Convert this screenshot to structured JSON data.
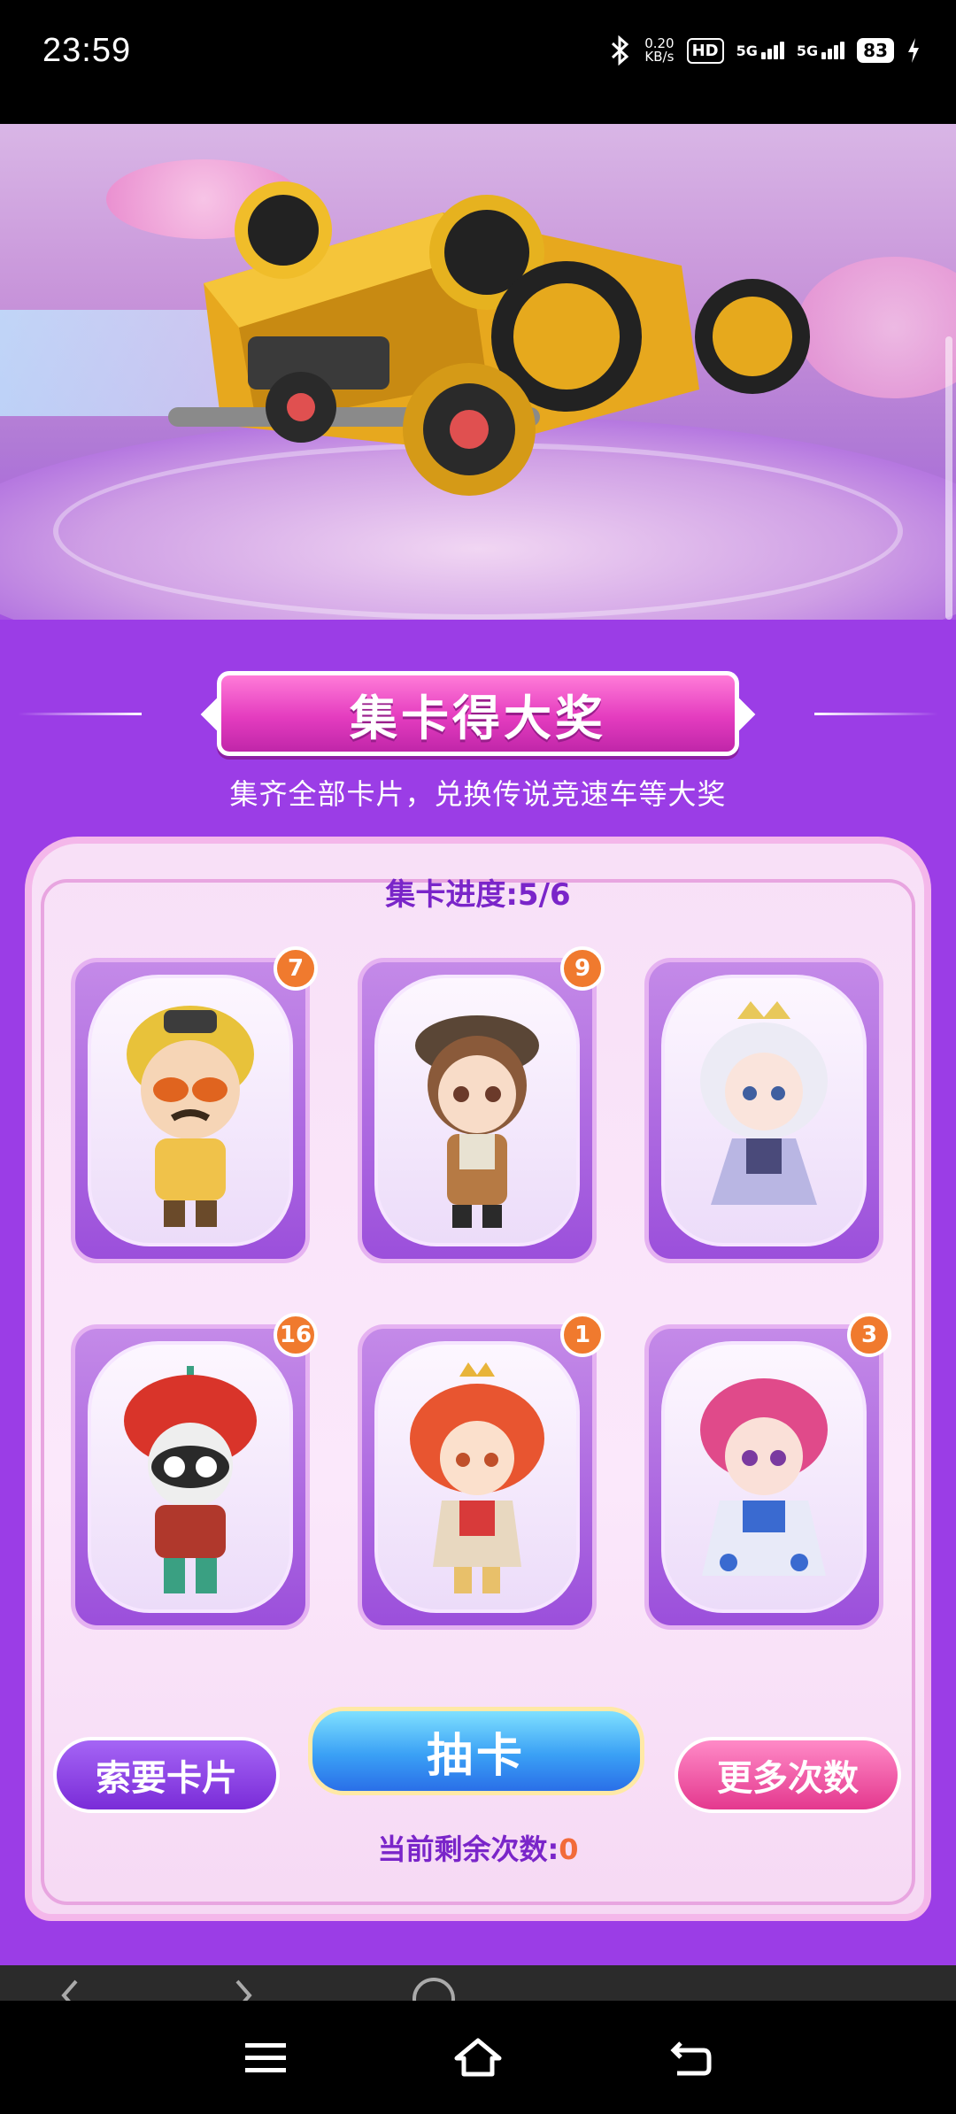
{
  "status_bar": {
    "time": "23:59",
    "net_speed_value": "0.20",
    "net_speed_unit": "KB/s",
    "hd_label": "HD",
    "sim1": "5G",
    "sim2": "5G",
    "battery": "83"
  },
  "event": {
    "title": "集卡得大奖",
    "subtitle": "集齐全部卡片，兑换传说竞速车等大奖",
    "progress_text": "集卡进度:5/6"
  },
  "cards": [
    {
      "name": "card-explorer",
      "count": "7"
    },
    {
      "name": "card-girl-brown",
      "count": "9"
    },
    {
      "name": "card-princess-white",
      "count": ""
    },
    {
      "name": "card-red-hat",
      "count": "16"
    },
    {
      "name": "card-red-hair",
      "count": "1"
    },
    {
      "name": "card-pink-hair",
      "count": "3"
    }
  ],
  "buttons": {
    "ask_card": "索要卡片",
    "draw_card": "抽卡",
    "more_times": "更多次数"
  },
  "remaining": {
    "label": "当前剩余次数:",
    "value": "0"
  },
  "colors": {
    "accent_purple": "#7a25c9",
    "badge_orange": "#f07a2e",
    "title_pink": "#e43cbf"
  }
}
